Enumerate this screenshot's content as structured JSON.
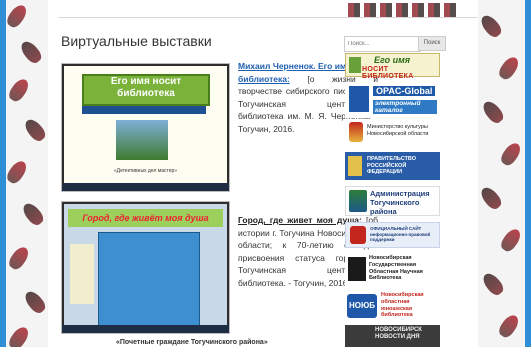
{
  "page": {
    "title": "Виртуальные выставки"
  },
  "search": {
    "placeholder": "Поиск...",
    "button_label": "Поиск"
  },
  "exhibitions": [
    {
      "thumb_banner": "Его имя носит библиотека",
      "thumb_caption": "«Детективных дел мастер»",
      "link_text": "Михаил Черненок. Его имя носит библиотека:",
      "description": "[о жизни и творчестве сибирского писателя] / Тогучинская центральная библиотека им. М. Я. Черненка. - Тогучин, 2016."
    },
    {
      "thumb_banner": "Город, где живёт моя душа",
      "link_text": "Город, где живет моя душа:",
      "description": "[об истории г. Тогучина Новосибирской области; к 70-летию со дня присвоения статуса города] / Тогучинская центральная библиотека. - Тогучин, 2016."
    }
  ],
  "bottom_caption": "«Почетные граждане Тогучинского района»",
  "sidebar_banners": {
    "egoimya_line1": "Его имя",
    "egoimya_line2": "НОСИТ БИБЛИОТЕКА",
    "opac_line1": "OPAC-Global",
    "opac_line2": "электронный каталог",
    "mincult": "Министерство культуры Новосибирской области",
    "prav": "ПРАВИТЕЛЬСТВО РОССИЙСКОЙ ФЕДЕРАЦИИ",
    "admin": "Администрация Тогучинского района",
    "official": "ОФИЦИАЛЬНЫЙ САЙТ информационно-правовой поддержки",
    "ngonb": "Новосибирская Государственная Областная Научная Библиотека",
    "noyub_logo": "НОЮБ",
    "noyub": "Новосибирская областная юношеская библиотека",
    "last": "НОВОСИБИРСК НОВОСТИ ДНЯ"
  },
  "colors": {
    "frame": "#2f8fd6",
    "link": "#1f5fb0"
  }
}
